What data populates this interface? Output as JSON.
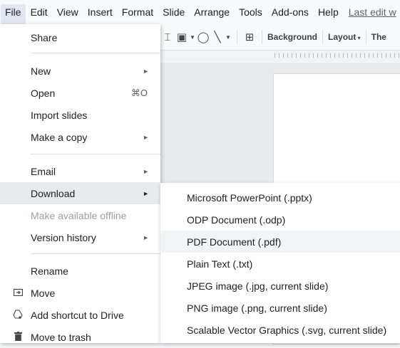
{
  "menubar": {
    "items": [
      "File",
      "Edit",
      "View",
      "Insert",
      "Format",
      "Slide",
      "Arrange",
      "Tools",
      "Add-ons",
      "Help"
    ],
    "last_edit": "Last edit w"
  },
  "toolbar": {
    "background_label": "Background",
    "layout_label": "Layout",
    "theme_label": "The"
  },
  "file_menu": {
    "share": "Share",
    "new": "New",
    "open": "Open",
    "open_shortcut": "⌘O",
    "import_slides": "Import slides",
    "make_copy": "Make a copy",
    "email": "Email",
    "download": "Download",
    "make_offline": "Make available offline",
    "version_history": "Version history",
    "rename": "Rename",
    "move": "Move",
    "add_shortcut": "Add shortcut to Drive",
    "move_to_trash": "Move to trash"
  },
  "download_submenu": {
    "items": [
      "Microsoft PowerPoint (.pptx)",
      "ODP Document (.odp)",
      "PDF Document (.pdf)",
      "Plain Text (.txt)",
      "JPEG image (.jpg, current slide)",
      "PNG image (.png, current slide)",
      "Scalable Vector Graphics (.svg, current slide)"
    ],
    "highlighted_index": 2
  },
  "icons": {
    "move": "folder-move-icon",
    "add_shortcut": "drive-shortcut-icon",
    "trash": "trash-icon"
  },
  "colors": {
    "menu_highlight": "#e8eaed",
    "disabled_text": "#9aa0a6"
  }
}
